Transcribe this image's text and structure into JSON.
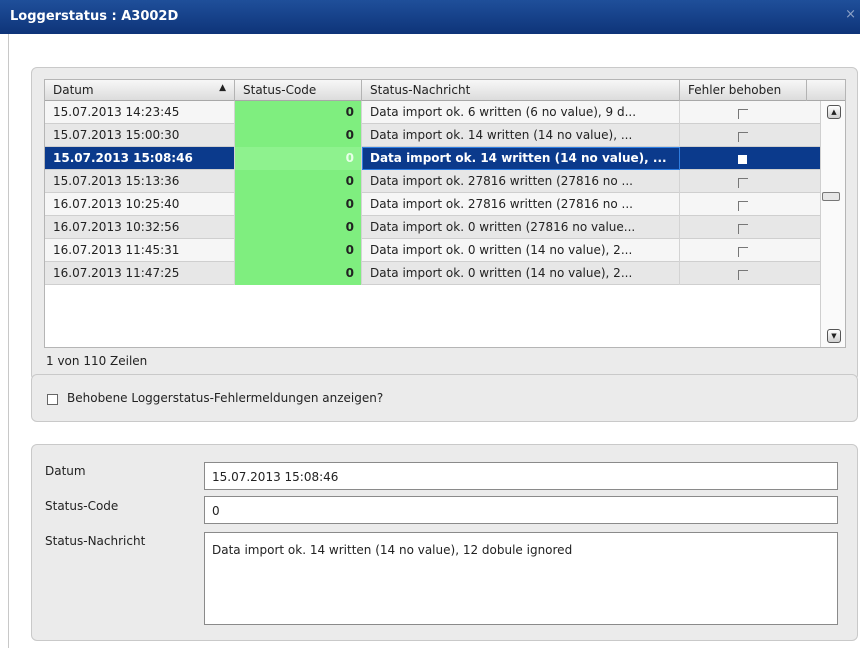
{
  "window": {
    "title": "Loggerstatus : A3002D",
    "close_glyph": "×"
  },
  "grid": {
    "columns": [
      "Datum",
      "Status-Code",
      "Status-Nachricht",
      "Fehler behoben"
    ],
    "sort_icon": "▲",
    "rows": [
      {
        "datum": "15.07.2013 14:23:45",
        "code": "0",
        "msg": "Data import ok. 6 written (6 no value), 9 d...",
        "fixed": false
      },
      {
        "datum": "15.07.2013 15:00:30",
        "code": "0",
        "msg": "Data import ok. 14 written (14 no value), ...",
        "fixed": false
      },
      {
        "datum": "15.07.2013 15:08:46",
        "code": "0",
        "msg": "Data import ok. 14 written (14 no value), ...",
        "fixed": true
      },
      {
        "datum": "15.07.2013 15:13:36",
        "code": "0",
        "msg": "Data import ok. 27816 written (27816 no ...",
        "fixed": false
      },
      {
        "datum": "16.07.2013 10:25:40",
        "code": "0",
        "msg": "Data import ok. 27816 written (27816 no ...",
        "fixed": false
      },
      {
        "datum": "16.07.2013 10:32:56",
        "code": "0",
        "msg": "Data import ok. 0 written (27816 no value...",
        "fixed": false
      },
      {
        "datum": "16.07.2013 11:45:31",
        "code": "0",
        "msg": "Data import ok. 0 written (14 no value), 2...",
        "fixed": false
      },
      {
        "datum": "16.07.2013 11:47:25",
        "code": "0",
        "msg": "Data import ok. 0 written (14 no value), 2...",
        "fixed": false
      }
    ],
    "selected_index": 2,
    "row_count_text": "1 von 110 Zeilen"
  },
  "filter": {
    "label": "Behobene Loggerstatus-Fehlermeldungen anzeigen?",
    "checked": false
  },
  "details": {
    "datum_label": "Datum",
    "datum_value": "15.07.2013 15:08:46",
    "code_label": "Status-Code",
    "code_value": "0",
    "msg_label": "Status-Nachricht",
    "msg_value": "Data import ok. 14 written (14 no value), 12 dobule ignored"
  },
  "colors": {
    "titlebar": "#0e3479",
    "status_ok": "#7fee7f",
    "selection": "#0b3a8c"
  }
}
